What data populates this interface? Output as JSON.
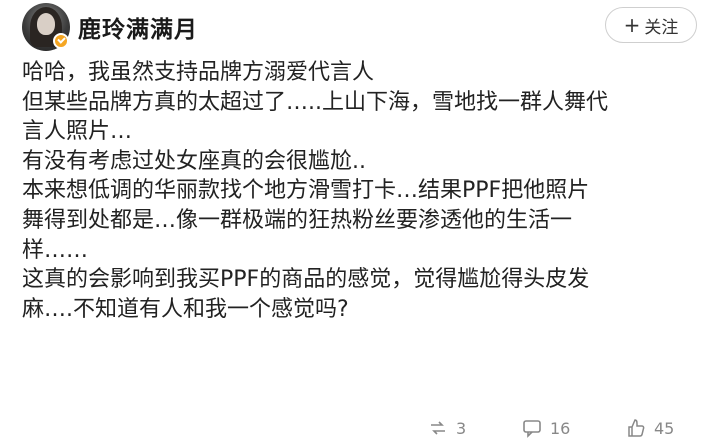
{
  "header": {
    "username": "鹿玲满满月",
    "follow_label": "关注"
  },
  "post": {
    "lines": [
      "哈哈，我虽然支持品牌方溺爱代言人",
      "但某些品牌方真的太超过了…..上山下海，雪地找一群人舞代",
      "言人照片…",
      "有没有考虑过处女座真的会很尴尬..",
      "本来想低调的华丽款找个地方滑雪打卡…结果PPF把他照片",
      "舞得到处都是…像一群极端的狂热粉丝要渗透他的生活一",
      "样……",
      "这真的会影响到我买PPF的商品的感觉，觉得尴尬得头皮发",
      "麻….不知道有人和我一个感觉吗?"
    ]
  },
  "footer": {
    "repost_count": "3",
    "comment_count": "16",
    "like_count": "45"
  },
  "icons": {
    "verified": "verified-badge-icon",
    "repost": "repost-icon",
    "comment": "comment-icon",
    "like": "like-icon"
  },
  "colors": {
    "verified_badge": "#f5a623",
    "text": "#222222",
    "meta": "#888888"
  }
}
